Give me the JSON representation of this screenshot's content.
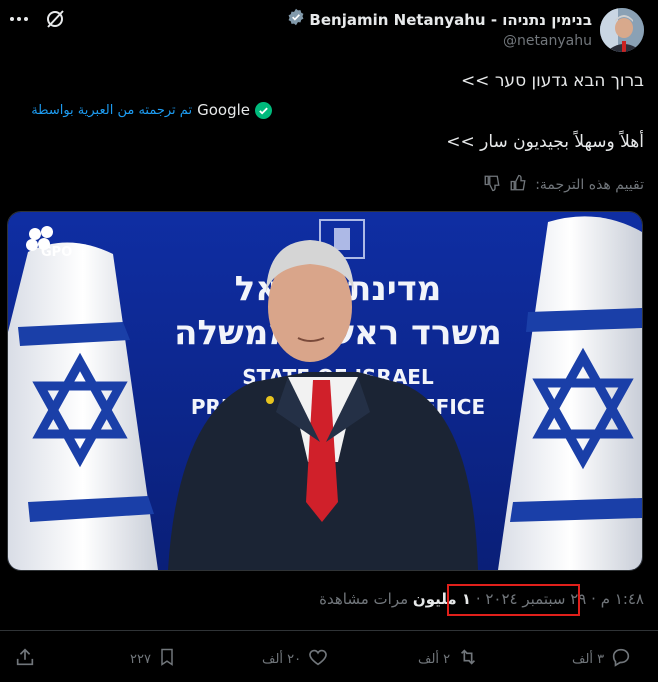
{
  "header": {
    "display_name": "Benjamin Netanyahu - בנימין נתניהו",
    "handle": "@netanyahu"
  },
  "tweet": {
    "line1": "ברוך הבא גדעון סער >>",
    "translated_label": "تم ترجمته من العبرية بواسطة",
    "translated_provider": "Google",
    "line2": "أهلاً وسهلاً بجيديون سار >>",
    "rate_label": "تقييم هذه الترجمة:"
  },
  "media": {
    "watermark": "GPO",
    "backdrop_line1": "מדינת ישראל",
    "backdrop_line2": "משרד ראש הממשלה",
    "backdrop_line3": "STATE OF ISRAEL",
    "backdrop_line4": "PRIME MINISTER'S OFFICE"
  },
  "meta": {
    "time": "١:٤٨ م",
    "date": "٢٩ سبتمبر ٢٠٢٤",
    "views_count": "١ مليون",
    "views_label": "مرات مشاهدة"
  },
  "actions": {
    "reply_count": "٣ ألف",
    "repost_count": "٢ ألف",
    "like_count": "٢٠ ألف",
    "bookmark_count": "٢٢٧"
  },
  "colors": {
    "accent": "#1d9bf0",
    "highlight": "#e0201b",
    "tie": "#d0202a",
    "flag_blue": "#1a3fa8"
  }
}
